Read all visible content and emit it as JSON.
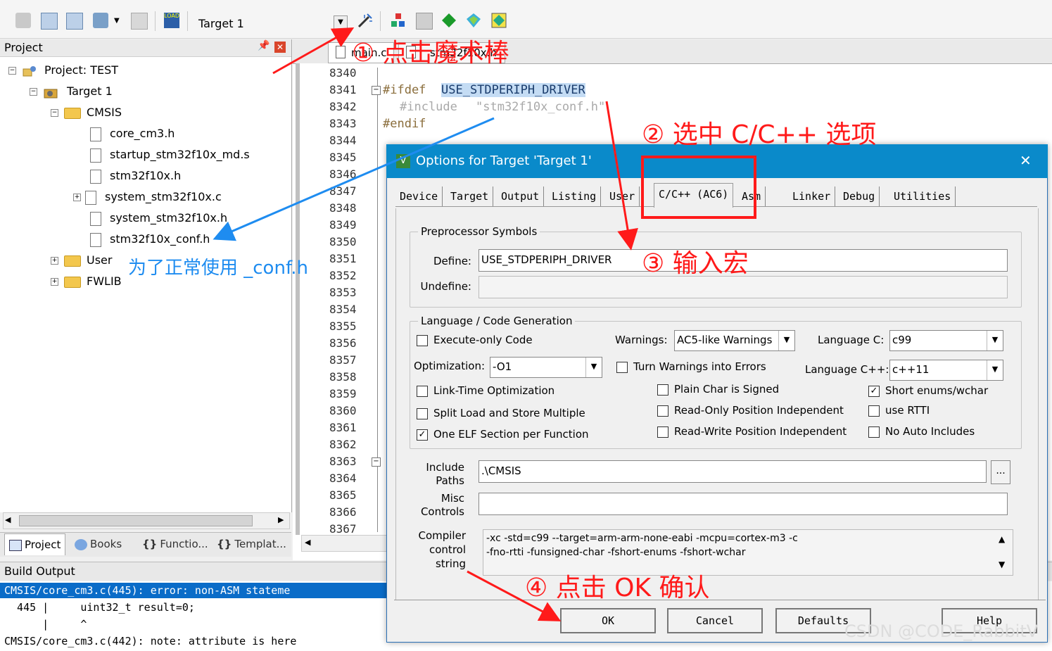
{
  "toolbar": {
    "target": "Target 1"
  },
  "project_panel": {
    "title": "Project",
    "tree": [
      "Project: TEST",
      "Target 1",
      "CMSIS",
      "core_cm3.h",
      "startup_stm32f10x_md.s",
      "stm32f10x.h",
      "system_stm32f10x.c",
      "system_stm32f10x.h",
      "stm32f10x_conf.h",
      "User",
      "FWLIB"
    ],
    "tabs": [
      "Project",
      "Books",
      "Functio...",
      "Templat..."
    ]
  },
  "editor": {
    "tabs": [
      "main.c",
      "stm32f10x.h"
    ],
    "line_numbers": [
      "8340",
      "8341",
      "8342",
      "8343",
      "8344",
      "8345",
      "8346",
      "8347",
      "8348",
      "8349",
      "8350",
      "8351",
      "8352",
      "8353",
      "8354",
      "8355",
      "8356",
      "8357",
      "8358",
      "8359",
      "8360",
      "8361",
      "8362",
      "8363",
      "8364",
      "8365",
      "8366",
      "8367"
    ],
    "code": {
      "ifdef": "#ifdef",
      "macro": "USE_STDPERIPH_DRIVER",
      "include": "#include",
      "include_file": "\"stm32f10x_conf.h\"",
      "endif": "#endif"
    }
  },
  "build_output": {
    "title": "Build Output",
    "lines": [
      "CMSIS/core_cm3.c(445): error: non-ASM stateme",
      "  445 |     uint32_t result=0;",
      "      |     ^",
      "CMSIS/core_cm3.c(442): note: attribute is here"
    ]
  },
  "dialog": {
    "title": "Options for Target 'Target 1'",
    "close": "✕",
    "tabs": [
      "Device",
      "Target",
      "Output",
      "Listing",
      "User",
      "C/C++ (AC6)",
      "Asm",
      "Linker",
      "Debug",
      "Utilities"
    ],
    "active_tab": "C/C++ (AC6)",
    "preprocessor": {
      "title": "Preprocessor Symbols",
      "define_label": "Define:",
      "define_value": "USE_STDPERIPH_DRIVER",
      "undefine_label": "Undefine:",
      "undefine_value": ""
    },
    "language": {
      "title": "Language / Code Generation",
      "execute_only": "Execute-only Code",
      "warnings_label": "Warnings:",
      "warnings_value": "AC5-like Warnings",
      "language_c_label": "Language C:",
      "language_c_value": "c99",
      "optimization_label": "Optimization:",
      "optimization_value": "-O1",
      "turn_warnings": "Turn Warnings into Errors",
      "language_cpp_label": "Language C++:",
      "language_cpp_value": "c++11",
      "lto": "Link-Time Optimization",
      "plain_char": "Plain Char is Signed",
      "short_enums": "Short enums/wchar",
      "split_load": "Split Load and Store Multiple",
      "ro_pi": "Read-Only Position Independent",
      "rtti": "use RTTI",
      "one_elf": "One ELF Section per Function",
      "rw_pi": "Read-Write Position Independent",
      "no_auto": "No Auto Includes"
    },
    "include_label_1": "Include",
    "include_label_2": "Paths",
    "include_value": ".\\CMSIS",
    "browse": "...",
    "misc_label_1": "Misc",
    "misc_label_2": "Controls",
    "misc_value": "",
    "compiler_label_1": "Compiler",
    "compiler_label_2": "control",
    "compiler_label_3": "string",
    "compiler_line_1": "-xc -std=c99 --target=arm-arm-none-eabi -mcpu=cortex-m3 -c",
    "compiler_line_2": "-fno-rtti -funsigned-char -fshort-enums -fshort-wchar",
    "buttons": {
      "ok": "OK",
      "cancel": "Cancel",
      "defaults": "Defaults",
      "help": "Help"
    }
  },
  "annotations": {
    "step1": "① 点击魔术棒",
    "step2": "② 选中 C/C++ 选项",
    "step3": "③ 输入宏",
    "step4": "④ 点击 OK 确认",
    "blue_note": "为了正常使用 _conf.h"
  },
  "watermark": "CSDN @CODE_RabbitV",
  "colors": {
    "dialog_title": "#0a8aca",
    "annotation_red": "#ff1a1a",
    "annotation_blue": "#1e8cf0",
    "build_error_bg": "#0a6cc8"
  }
}
